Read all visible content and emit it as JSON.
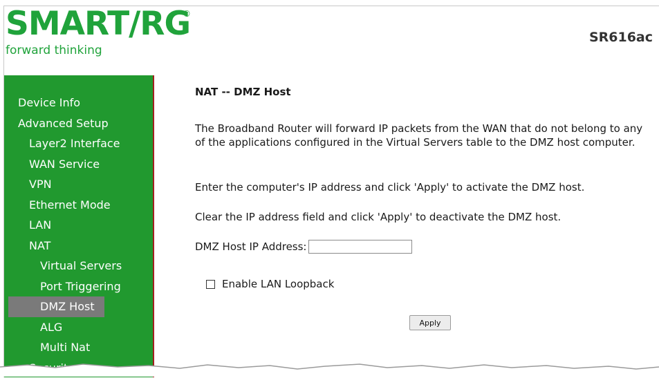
{
  "header": {
    "logo_text": "SMART/RG",
    "logo_registered": "®",
    "logo_tagline": "forward thinking",
    "model": "SR616ac"
  },
  "sidebar": {
    "items": [
      {
        "label": "Device Info",
        "level": 1
      },
      {
        "label": "Advanced Setup",
        "level": 1
      },
      {
        "label": "Layer2 Interface",
        "level": 2
      },
      {
        "label": "WAN Service",
        "level": 2
      },
      {
        "label": "VPN",
        "level": 2
      },
      {
        "label": "Ethernet Mode",
        "level": 2
      },
      {
        "label": "LAN",
        "level": 2
      },
      {
        "label": "NAT",
        "level": 2
      },
      {
        "label": "Virtual Servers",
        "level": 3
      },
      {
        "label": "Port Triggering",
        "level": 3
      },
      {
        "label": "DMZ Host",
        "level": 3,
        "selected": true
      },
      {
        "label": "ALG",
        "level": 3
      },
      {
        "label": "Multi Nat",
        "level": 3
      },
      {
        "label": "Security",
        "level": 2
      }
    ]
  },
  "main": {
    "title": "NAT -- DMZ Host",
    "description": "The Broadband Router will forward IP packets from the WAN that do not belong to any of the applications configured in the Virtual Servers table to the DMZ host computer.",
    "instruction_activate": "Enter the computer's IP address and click 'Apply' to activate the DMZ host.",
    "instruction_deactivate": "Clear the IP address field and click 'Apply' to deactivate the DMZ host.",
    "ip_label": "DMZ Host IP Address:",
    "ip_value": "",
    "loopback_label": "Enable LAN Loopback",
    "loopback_checked": false,
    "apply_label": "Apply"
  },
  "colors": {
    "brand_green": "#20a33b",
    "sidebar_green": "#21992f",
    "selected_gray": "#7a7a7a"
  }
}
